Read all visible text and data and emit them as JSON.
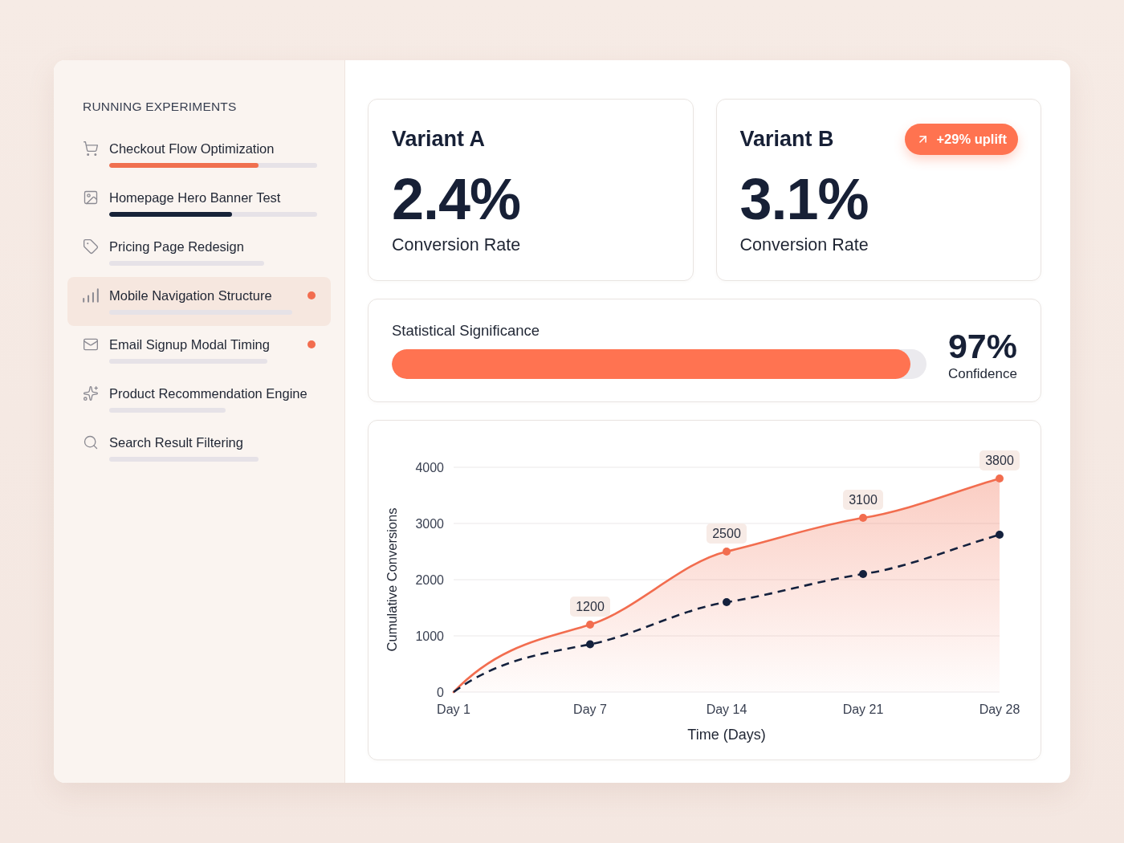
{
  "sidebar": {
    "heading": "RUNNING EXPERIMENTS",
    "experiments": [
      {
        "name": "Checkout Flow Optimization",
        "selected": false,
        "flagged": false,
        "level": 0.72,
        "color": "#f0704f"
      },
      {
        "name": "Homepage Hero Banner Test",
        "selected": false,
        "flagged": false,
        "level": 0.59,
        "color": "#172338"
      },
      {
        "name": "Pricing Page Redesign",
        "selected": false,
        "flagged": false
      },
      {
        "name": "Mobile Navigation Structure",
        "selected": true,
        "flagged": true
      },
      {
        "name": "Email Signup Modal Timing",
        "selected": false,
        "flagged": true
      },
      {
        "name": "Product Recommendation Engine",
        "selected": false,
        "flagged": false
      },
      {
        "name": "Search Result Filtering",
        "selected": false,
        "flagged": false
      }
    ]
  },
  "variants": [
    {
      "title": "Variant A",
      "value": "2.4%",
      "caption": "Conversion Rate"
    },
    {
      "title": "Variant B",
      "value": "3.1%",
      "caption": "Conversion Rate",
      "badge": "+29% uplift"
    }
  ],
  "significance": {
    "label": "Statistical Significance",
    "level": 0.97,
    "value": "97%",
    "caption": "Confidence"
  },
  "chart": {
    "chart_data": {
      "type": "line",
      "xlabel": "Time (Days)",
      "ylabel": "Cumulative Conversions",
      "categories": [
        "Day 1",
        "Day 7",
        "Day 14",
        "Day 21",
        "Day 28"
      ],
      "ylim": [
        0,
        4000
      ],
      "yticks": [
        0,
        1000,
        2000,
        3000,
        4000
      ],
      "grid": true,
      "series": [
        {
          "type": "area",
          "color": "#f26d4f",
          "line_style": "solid",
          "marker": "circle",
          "values": [
            0,
            1200,
            2500,
            3100,
            3800
          ]
        },
        {
          "type": "line",
          "color": "#14213d",
          "line_style": "dashed",
          "marker": "circle",
          "values": [
            0,
            850,
            1600,
            2100,
            2800
          ]
        }
      ],
      "annotations": [
        {
          "x": "Day 7",
          "y": 1200,
          "text": "1200"
        },
        {
          "x": "Day 14",
          "y": 2500,
          "text": "2500"
        },
        {
          "x": "Day 21",
          "y": 3100,
          "text": "3100"
        },
        {
          "x": "Day 28",
          "y": 3800,
          "text": "3800"
        }
      ]
    }
  }
}
